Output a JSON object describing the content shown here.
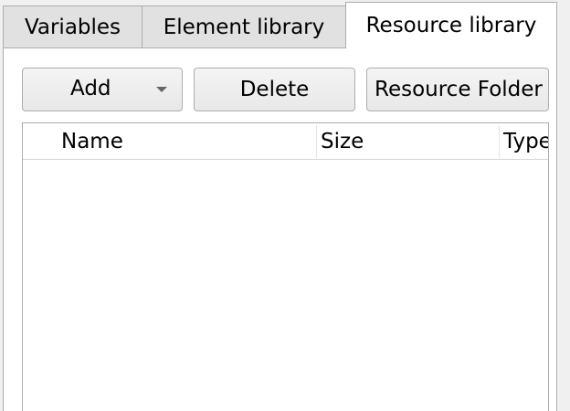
{
  "tabs": [
    {
      "label": "Variables",
      "active": false
    },
    {
      "label": "Element library",
      "active": false
    },
    {
      "label": "Resource library",
      "active": true
    }
  ],
  "toolbar": {
    "add_label": "Add",
    "delete_label": "Delete",
    "resource_folder_label": "Resource Folder"
  },
  "list": {
    "columns": [
      "Name",
      "Size",
      "Type"
    ],
    "rows": []
  },
  "icons": {
    "add_dropdown": "chevron-down-icon"
  }
}
